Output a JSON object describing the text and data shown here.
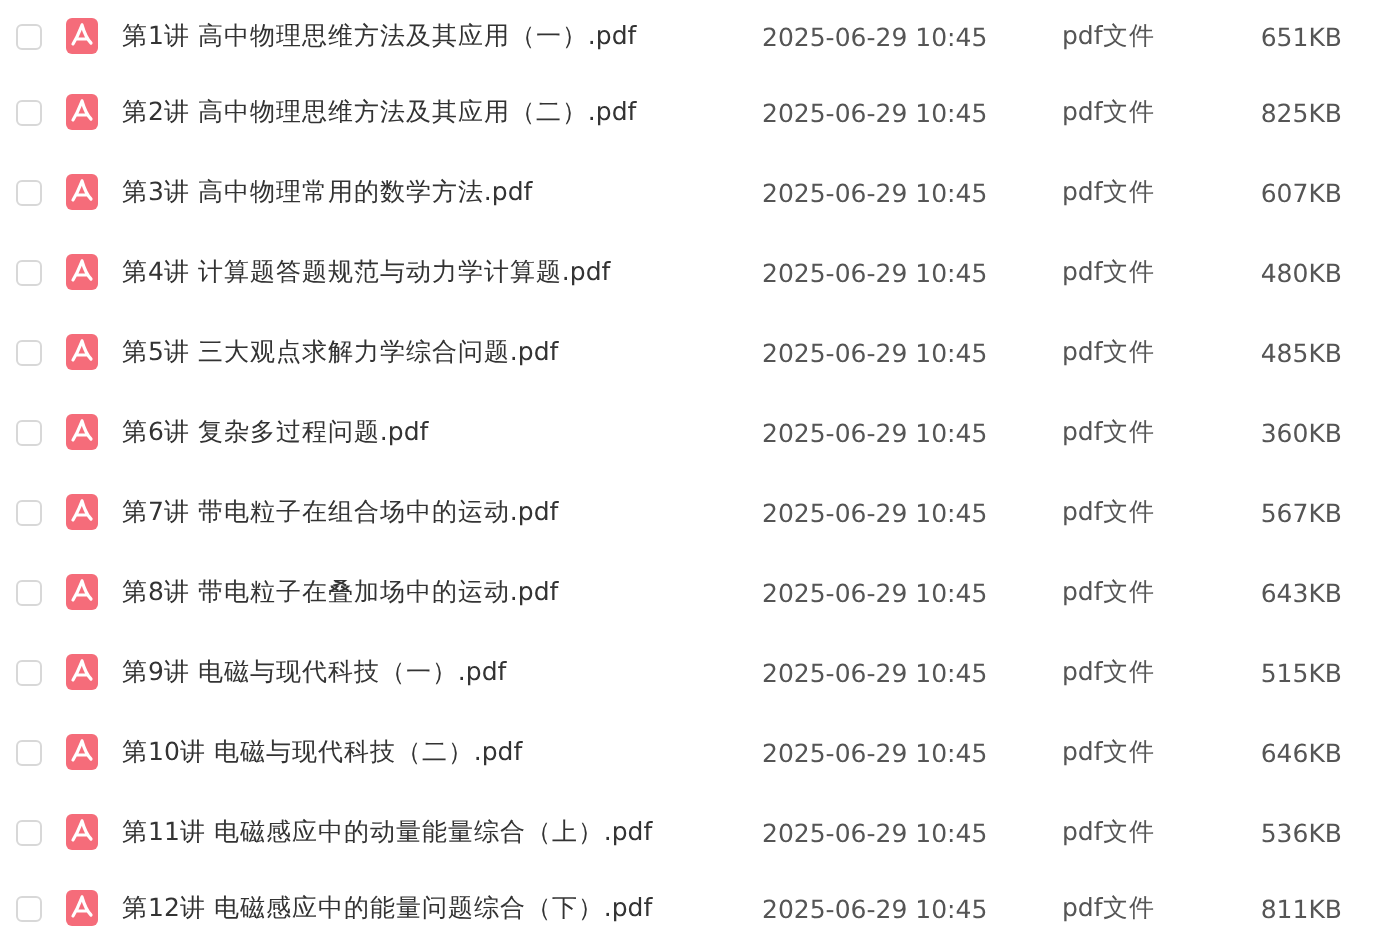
{
  "files": [
    {
      "name": "第1讲 高中物理思维方法及其应用（一）.pdf",
      "modified": "2025-06-29 10:45",
      "type": "pdf文件",
      "size": "651KB",
      "checked": false
    },
    {
      "name": "第2讲 高中物理思维方法及其应用（二）.pdf",
      "modified": "2025-06-29 10:45",
      "type": "pdf文件",
      "size": "825KB",
      "checked": false
    },
    {
      "name": "第3讲 高中物理常用的数学方法.pdf",
      "modified": "2025-06-29 10:45",
      "type": "pdf文件",
      "size": "607KB",
      "checked": false
    },
    {
      "name": "第4讲 计算题答题规范与动力学计算题.pdf",
      "modified": "2025-06-29 10:45",
      "type": "pdf文件",
      "size": "480KB",
      "checked": false
    },
    {
      "name": "第5讲 三大观点求解力学综合问题.pdf",
      "modified": "2025-06-29 10:45",
      "type": "pdf文件",
      "size": "485KB",
      "checked": false
    },
    {
      "name": "第6讲 复杂多过程问题.pdf",
      "modified": "2025-06-29 10:45",
      "type": "pdf文件",
      "size": "360KB",
      "checked": false
    },
    {
      "name": "第7讲 带电粒子在组合场中的运动.pdf",
      "modified": "2025-06-29 10:45",
      "type": "pdf文件",
      "size": "567KB",
      "checked": false
    },
    {
      "name": "第8讲 带电粒子在叠加场中的运动.pdf",
      "modified": "2025-06-29 10:45",
      "type": "pdf文件",
      "size": "643KB",
      "checked": false
    },
    {
      "name": "第9讲 电磁与现代科技（一）.pdf",
      "modified": "2025-06-29 10:45",
      "type": "pdf文件",
      "size": "515KB",
      "checked": false
    },
    {
      "name": "第10讲 电磁与现代科技（二）.pdf",
      "modified": "2025-06-29 10:45",
      "type": "pdf文件",
      "size": "646KB",
      "checked": false
    },
    {
      "name": "第11讲 电磁感应中的动量能量综合（上）.pdf",
      "modified": "2025-06-29 10:45",
      "type": "pdf文件",
      "size": "536KB",
      "checked": false
    },
    {
      "name": "第12讲 电磁感应中的能量问题综合（下）.pdf",
      "modified": "2025-06-29 10:45",
      "type": "pdf文件",
      "size": "811KB",
      "checked": false
    }
  ]
}
